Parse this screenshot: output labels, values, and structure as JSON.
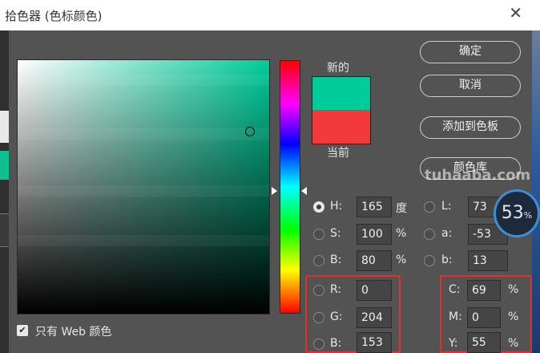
{
  "window": {
    "title": "拾色器 (色标颜色)",
    "close_glyph": "✕"
  },
  "preview": {
    "new_label": "新的",
    "current_label": "当前",
    "new_color": "#00cc99",
    "current_color": "#f23a3a"
  },
  "buttons": {
    "ok": "确定",
    "cancel": "取消",
    "add_to_swatches": "添加到色板",
    "color_libraries": "颜色库"
  },
  "hsb": {
    "h": {
      "label": "H:",
      "value": "165",
      "unit": "度"
    },
    "s": {
      "label": "S:",
      "value": "100",
      "unit": "%"
    },
    "b": {
      "label": "B:",
      "value": "80",
      "unit": "%"
    }
  },
  "lab": {
    "l": {
      "label": "L:",
      "value": "73"
    },
    "a": {
      "label": "a:",
      "value": "-53"
    },
    "b": {
      "label": "b:",
      "value": "13"
    }
  },
  "rgb": {
    "r": {
      "label": "R:",
      "value": "0"
    },
    "g": {
      "label": "G:",
      "value": "204"
    },
    "b": {
      "label": "B:",
      "value": "153"
    }
  },
  "cmyk": {
    "c": {
      "label": "C:",
      "value": "69",
      "unit": "%"
    },
    "m": {
      "label": "M:",
      "value": "0",
      "unit": "%"
    },
    "y": {
      "label": "Y:",
      "value": "55",
      "unit": "%"
    }
  },
  "web_only": {
    "label": "只有 Web 颜色",
    "checked": true,
    "check_glyph": "✔"
  },
  "watermark": "tuhaaba.com",
  "badge": {
    "number": "53",
    "unit": "%"
  },
  "colors": {
    "highlight_box": "#e03030",
    "field_hue": "#00cc99"
  }
}
